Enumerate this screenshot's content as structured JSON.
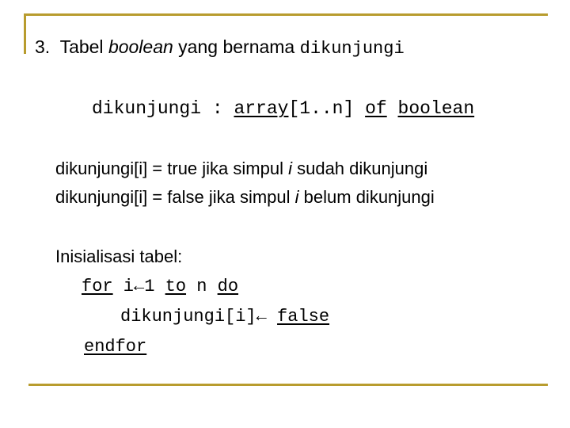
{
  "colors": {
    "accent_rule": "#b89c2e",
    "text": "#000000",
    "background": "#ffffff"
  },
  "heading": {
    "number": "3.",
    "prefix": "Tabel ",
    "italic_word": "boolean",
    "suffix": " yang bernama ",
    "code_name": "dikunjungi"
  },
  "declaration": {
    "name": "dikunjungi",
    "colon": " : ",
    "kw_array": "array",
    "range": "[1..n]",
    "kw_of": "of",
    "kw_boolean": "boolean"
  },
  "meaning": [
    {
      "prefix": "dikunjungi[i] = true jika simpul ",
      "var": "i",
      "suffix": " sudah dikunjungi"
    },
    {
      "prefix": "dikunjungi[i] = false jika simpul ",
      "var": "i",
      "suffix": " belum dikunjungi"
    }
  ],
  "init": {
    "label": "Inisialisasi tabel:",
    "code": {
      "kw_for": "for",
      "loop_var": " i←1 ",
      "kw_to": "to",
      "limit": " n ",
      "kw_do": "do",
      "assign": "dikunjungi[i]← ",
      "kw_false": "false",
      "kw_endfor": "endfor"
    }
  }
}
